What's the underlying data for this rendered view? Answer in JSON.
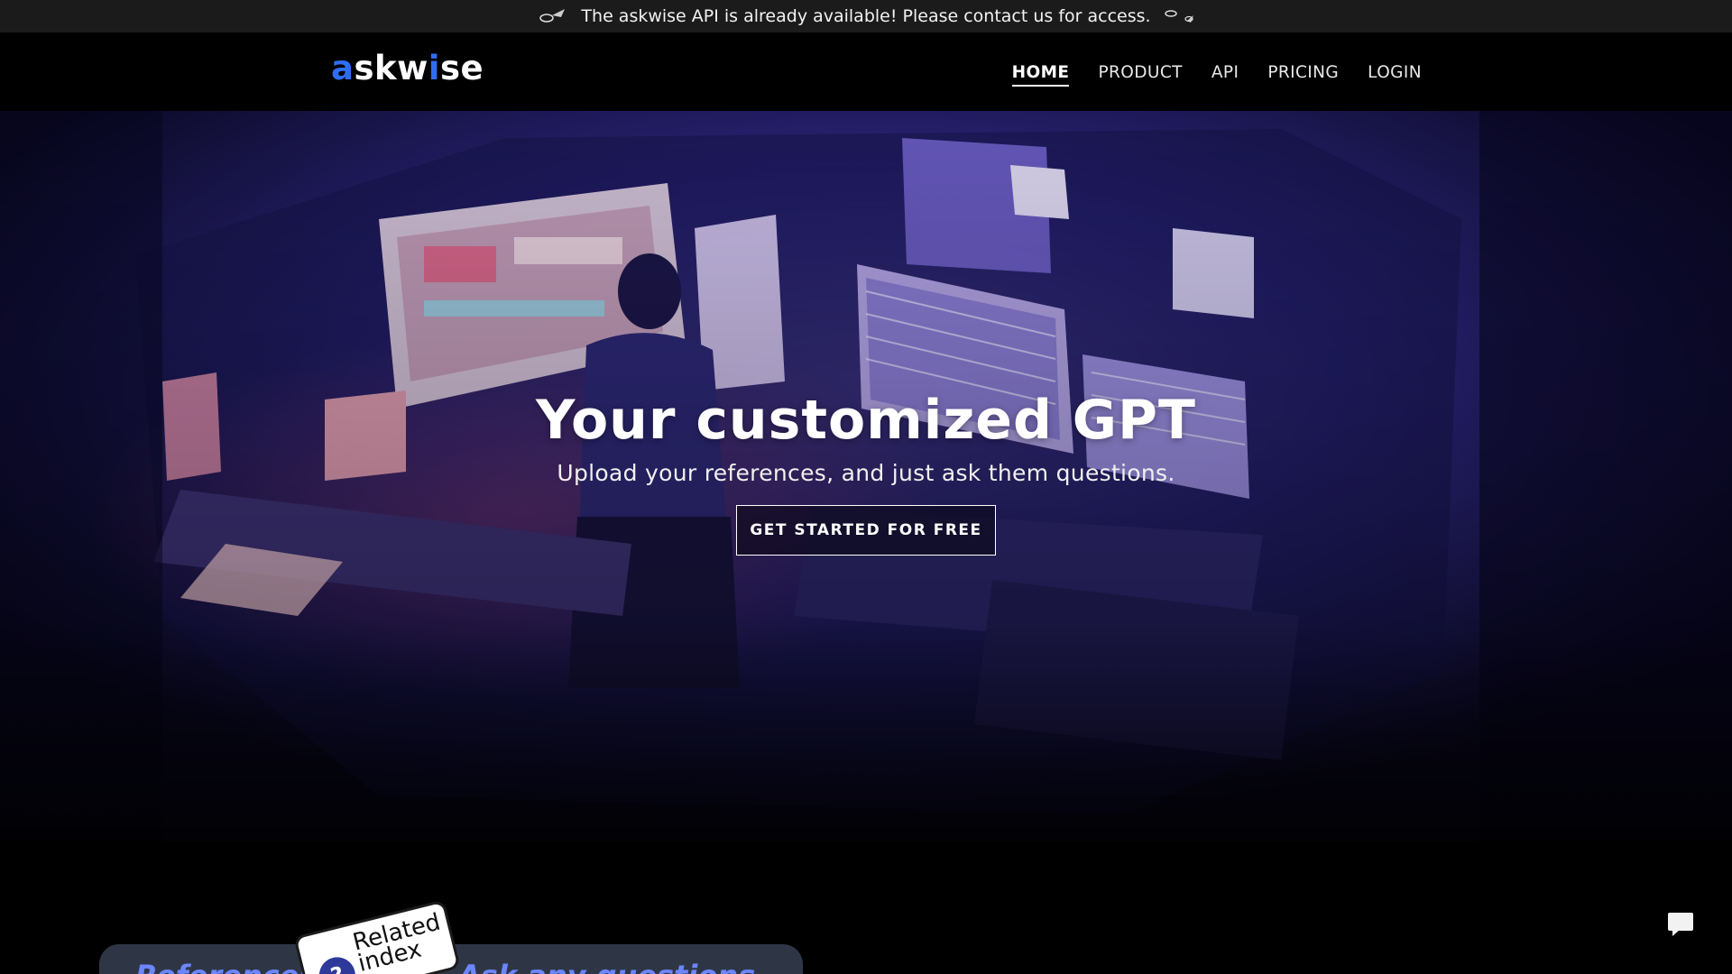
{
  "announcement": {
    "text": "The askwise API is already available! Please contact us for access.",
    "left_icon": "rocket-icon",
    "right_icon": "rocket-icon"
  },
  "header": {
    "logo_part1": "a",
    "logo_part2": "skw",
    "logo_part3": "i",
    "logo_part4": "se",
    "nav": [
      {
        "label": "HOME",
        "active": true
      },
      {
        "label": "PRODUCT",
        "active": false
      },
      {
        "label": "API",
        "active": false
      },
      {
        "label": "PRICING",
        "active": false
      },
      {
        "label": "LOGIN",
        "active": false
      }
    ]
  },
  "hero": {
    "title": "Your customized GPT",
    "subtitle": "Upload your references, and just ask them questions.",
    "cta_label": "GET STARTED FOR FREE"
  },
  "preview": {
    "left_text": "References",
    "right_text": "Ask any questions",
    "tag_text": "Related index",
    "tag_icon": "question-icon"
  },
  "chat": {
    "icon": "chat-bubble-icon"
  },
  "colors": {
    "brand_blue": "#2f6df2",
    "announce_bg": "#1b1b1b",
    "header_bg": "#000000",
    "hero_bg": "#0b0a2a"
  }
}
